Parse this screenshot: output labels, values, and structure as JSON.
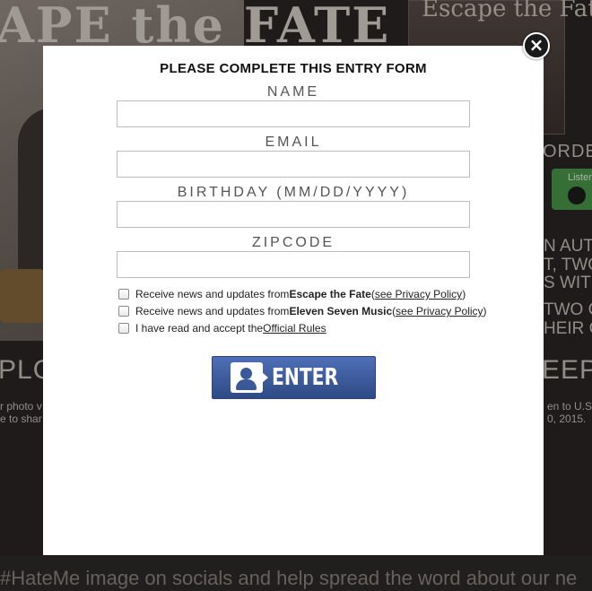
{
  "background": {
    "band_logo": "APE the FATE",
    "album_title": "Escape the Fate",
    "preorder": "ORDE",
    "listen": "Listen",
    "description_lines": [
      "N AUTO",
      "T, TWO",
      "S WITH",
      "TWO C",
      "HEIR C"
    ],
    "explore": "PLO",
    "sweeps": "EEPS",
    "small_left": [
      "r photo v",
      "e to shar"
    ],
    "small_right": [
      "en to U.S.",
      "0, 2015."
    ],
    "hashtag_line": "#HateMe image on socials and help spread the word about our ne"
  },
  "modal": {
    "title": "PLEASE COMPLETE THIS ENTRY FORM",
    "close_symbol": "×",
    "fields": {
      "name": {
        "label": "NAME",
        "value": "",
        "placeholder": ""
      },
      "email": {
        "label": "EMAIL",
        "value": "",
        "placeholder": ""
      },
      "birthday": {
        "label": "BIRTHDAY (MM/DD/YYYY)",
        "value": "",
        "placeholder": ""
      },
      "zipcode": {
        "label": "ZIPCODE",
        "value": "",
        "placeholder": ""
      }
    },
    "checkboxes": [
      {
        "prefix": "Receive news and updates from ",
        "bold": "Escape the Fate",
        "open": " (",
        "link": "see Privacy Policy",
        "close": ")",
        "checked": false
      },
      {
        "prefix": "Receive news and updates from ",
        "bold": "Eleven Seven Music",
        "open": " (",
        "link": "see Privacy Policy",
        "close": ")",
        "checked": false
      },
      {
        "prefix": "I have read and accept the ",
        "link": "Official Rules",
        "checked": false
      }
    ],
    "enter_button": {
      "label": "ENTER",
      "icon": "facebook-profile-icon",
      "color": "#3b5998"
    }
  }
}
